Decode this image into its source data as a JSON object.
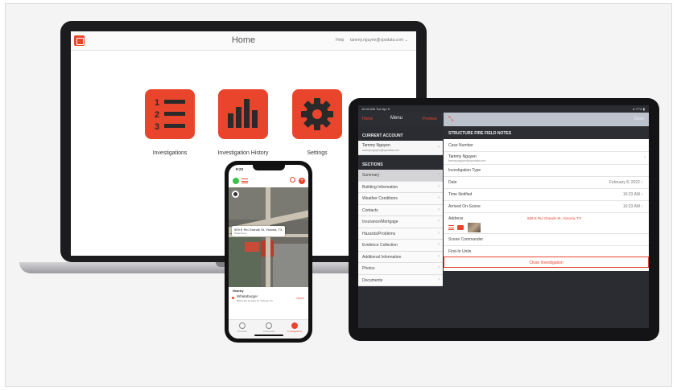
{
  "laptop": {
    "page_title": "Home",
    "help_label": "Help",
    "user_email": "tammy.nguyen@xpodata.com ⌄",
    "tiles": [
      {
        "label": "Investigations",
        "icon": "numbered-list-icon"
      },
      {
        "label": "Investigation History",
        "icon": "bar-chart-icon"
      },
      {
        "label": "Settings",
        "icon": "gear-icon"
      }
    ]
  },
  "tablet": {
    "status": {
      "left": "10:04 AM  Tue Apr 5",
      "right": "● 77% ▮"
    },
    "nav": {
      "home": "Home",
      "menu": "Menu",
      "preview": "Preview",
      "done": "Done"
    },
    "current_account": {
      "header": "CURRENT ACCOUNT",
      "name": "Tammy Nguyen",
      "email": "tammy.nguyen@xpodata.com"
    },
    "sections_header": "SECTIONS",
    "sections": [
      "Summary",
      "Building Information",
      "Weather Conditions",
      "Contacts",
      "Insurance/Mortgage",
      "Hazards/Problems",
      "Evidence Collection",
      "Additional Information",
      "Photos",
      "Documents"
    ],
    "form": {
      "header": "STRUCTURE FIRE FIELD NOTES",
      "case_number_label": "Case Number",
      "investigator_name": "Tammy Nguyen",
      "investigator_email": "tammy.nguyen@xpodata.com",
      "investigation_type_label": "Investigation Type",
      "date_label": "Date",
      "date_value": "February 8, 2022 ›",
      "time_notified_label": "Time Notified",
      "time_notified_value": "10:23 AM ›",
      "arrived_label": "Arrived On-Scene",
      "arrived_value": "10:23 AM ›",
      "address_label": "Address",
      "address_value": "509 E Rio Grande St, Victoria, TX",
      "scene_commander_label": "Scene Commander",
      "first_in_units_label": "First-In Units",
      "close_button": "Close Investigation"
    }
  },
  "phone": {
    "time": "9:23",
    "callout_title": "509 E Rio Grande St, Victoria, TX",
    "callout_sub": "Press here",
    "nearby_header": "Nearby",
    "nearby_name": "Whataburger",
    "nearby_address": "509 E Rio Grande St, Victoria, TX",
    "open_label": "Open",
    "tabs": [
      "Previous",
      "Favourites",
      "Investigations"
    ]
  },
  "colors": {
    "brand": "#e8452c",
    "dark": "#1c1c1e",
    "panel": "#2c2e34"
  }
}
